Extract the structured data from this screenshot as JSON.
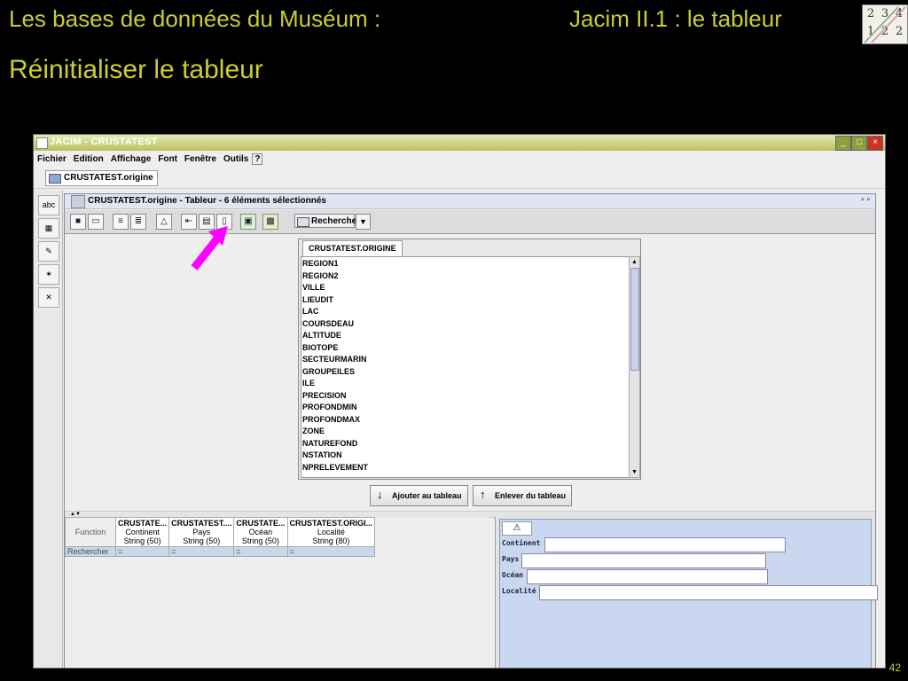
{
  "slide": {
    "title_left": "Les bases de données du Muséum :",
    "title_right": "Jacim II.1 : le tableur",
    "subtitle": "Réinitialiser le tableur",
    "page_number": "42",
    "logo_digits": [
      "2",
      "3",
      "4",
      "1",
      "2",
      "2"
    ],
    "accent_color": "#cccc33"
  },
  "app": {
    "window_title": "JACIM - CRUSTATEST",
    "menu": [
      "Fichier",
      "Edition",
      "Affichage",
      "Font",
      "Fenêtre",
      "Outils",
      "?"
    ],
    "db_tab": "CRUSTATEST.origine",
    "left_tools": [
      "abc",
      "grid-icon",
      "pencil-icon",
      "tools-icon",
      "wrench-icon"
    ],
    "inner_window": {
      "title": "CRUSTATEST.origine - Tableur - 6 éléments sélectionnés",
      "search_button": "Rechercher"
    },
    "field_list": {
      "tab": "CRUSTATEST.ORIGINE",
      "items": [
        "REGION1",
        "REGION2",
        "VILLE",
        "LIEUDIT",
        "LAC",
        "COURSDEAU",
        "ALTITUDE",
        "BIOTOPE",
        "SECTEURMARIN",
        "GROUPEILES",
        "ILE",
        "PRECISION",
        "PROFONDMIN",
        "PROFONDMAX",
        "ZONE",
        "NATUREFOND",
        "NSTATION",
        "NPRELEVEMENT"
      ]
    },
    "buttons": {
      "add": "Ajouter au tableau",
      "remove": "Enlever du tableau"
    },
    "grid": {
      "row_label_function": "Function",
      "row_label_search": "Rechercher",
      "columns": [
        {
          "header": "CRUSTATE...",
          "name": "Continent",
          "type": "String (50)",
          "search": "="
        },
        {
          "header": "CRUSTATEST....",
          "name": "Pays",
          "type": "String (50)",
          "search": "="
        },
        {
          "header": "CRUSTATE...",
          "name": "Océan",
          "type": "String (50)",
          "search": "="
        },
        {
          "header": "CRUSTATEST.ORIGI...",
          "name": "Localité",
          "type": "String (80)",
          "search": "="
        }
      ]
    },
    "form": {
      "fields": [
        {
          "label": "Continent",
          "value": ""
        },
        {
          "label": "Pays",
          "value": ""
        },
        {
          "label": "Océan",
          "value": ""
        },
        {
          "label": "Localité",
          "value": ""
        }
      ]
    }
  }
}
